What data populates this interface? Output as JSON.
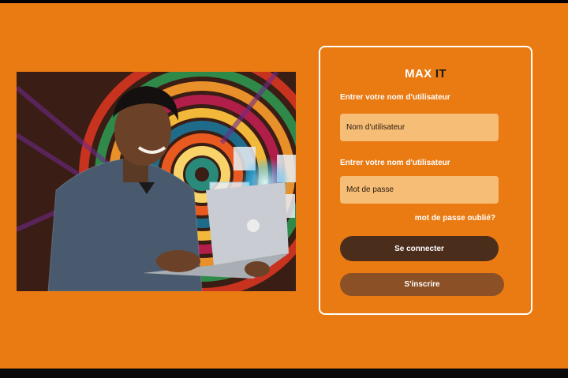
{
  "brand": {
    "part1": "MAX",
    "part2": " IT"
  },
  "form": {
    "username_label": "Entrer votre nom d'utilisateur",
    "username_placeholder": "Nom d'utilisateur",
    "password_label": "Entrer votre nom d'utilisateur",
    "password_placeholder": "Mot de passe",
    "forgot_link": "mot de passe oublié?",
    "login_button": "Se connecter",
    "signup_button": "S'inscrire"
  },
  "colors": {
    "background": "#ea7a12",
    "field": "#f6bd77",
    "login_button": "#4b2d1c",
    "signup_button": "#8c5026"
  }
}
